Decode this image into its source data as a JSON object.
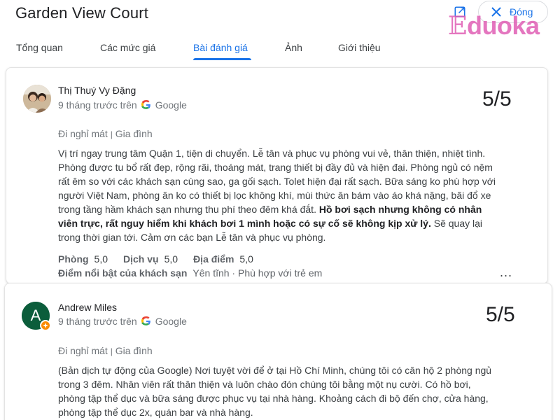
{
  "header": {
    "title": "Garden View Court",
    "open_icon": "open-in-new-icon",
    "close_label": "Đóng",
    "watermark": "Eduoka"
  },
  "tabs": [
    {
      "label": "Tổng quan",
      "active": false
    },
    {
      "label": "Các mức giá",
      "active": false
    },
    {
      "label": "Bài đánh giá",
      "active": true
    },
    {
      "label": "Ảnh",
      "active": false
    },
    {
      "label": "Giới thiệu",
      "active": false
    }
  ],
  "accent_color": "#1a73e8",
  "reviews": [
    {
      "author": "Thị Thuý Vy Đặng",
      "time": "9 tháng trước trên",
      "source": "Google",
      "score": "5/5",
      "trip_type": "Đi nghỉ mát",
      "separator": "|",
      "group": "Gia đình",
      "text_normal": "Vị trí ngay trung tâm Quận 1, tiện di chuyển. Lễ tân và phục vụ phòng vui vẻ, thân thiện, nhiệt tình. Phòng được tu bổ rất đẹp, rộng rãi, thoáng mát, trang thiết bị đầy đủ và hiện đại. Phòng ngủ có nệm rất êm so với các khách sạn cùng sao, ga gối sạch. Tolet hiện đại rất sạch. Bữa sáng ko phù hợp với người Việt Nam, phòng ăn ko có thiết bị lọc không khí, mùi thức ăn bám vào áo khá nặng, bãi đổ xe trong tầng hầm khách sạn nhưng thu phí theo đêm khá đắt. ",
      "text_bold": "Hồ bơi sạch nhưng không có nhân viên trực, rất nguy hiểm khi khách bơi 1 mình hoặc có sự cố sẽ không kịp xử lý.",
      "text_end": " Sẽ quay lại trong thời gian tới. Cảm ơn các bạn Lễ tân và phục vụ phòng.",
      "ratings": [
        {
          "label": "Phòng",
          "value": "5,0"
        },
        {
          "label": "Dịch vụ",
          "value": "5,0"
        },
        {
          "label": "Địa điểm",
          "value": "5,0"
        }
      ],
      "highlights_label": "Điểm nổi bật của khách sạn",
      "highlights_value": "Yên tĩnh · Phù hợp với trẻ em",
      "more": "..."
    },
    {
      "author": "Andrew Miles",
      "avatar_letter": "A",
      "avatar_color": "#0b5d3b",
      "time": "9 tháng trước trên",
      "source": "Google",
      "score": "5/5",
      "trip_type": "Đi nghỉ mát",
      "separator": "|",
      "group": "Gia đình",
      "text_normal": "(Bản dịch tự động của Google) Nơi tuyệt vời để ở tại Hồ Chí Minh, chúng tôi có căn hộ 2 phòng ngủ trong 3 đêm. Nhân viên rất thân thiện và luôn chào đón chúng tôi bằng một nụ cười. Có hồ bơi, phòng tập thể dục và bữa sáng được phục vụ tại nhà hàng. Khoảng cách đi bộ đến chợ, cửa hàng, phòng tập thể dục 2x, quán bar và nhà hàng."
    }
  ]
}
